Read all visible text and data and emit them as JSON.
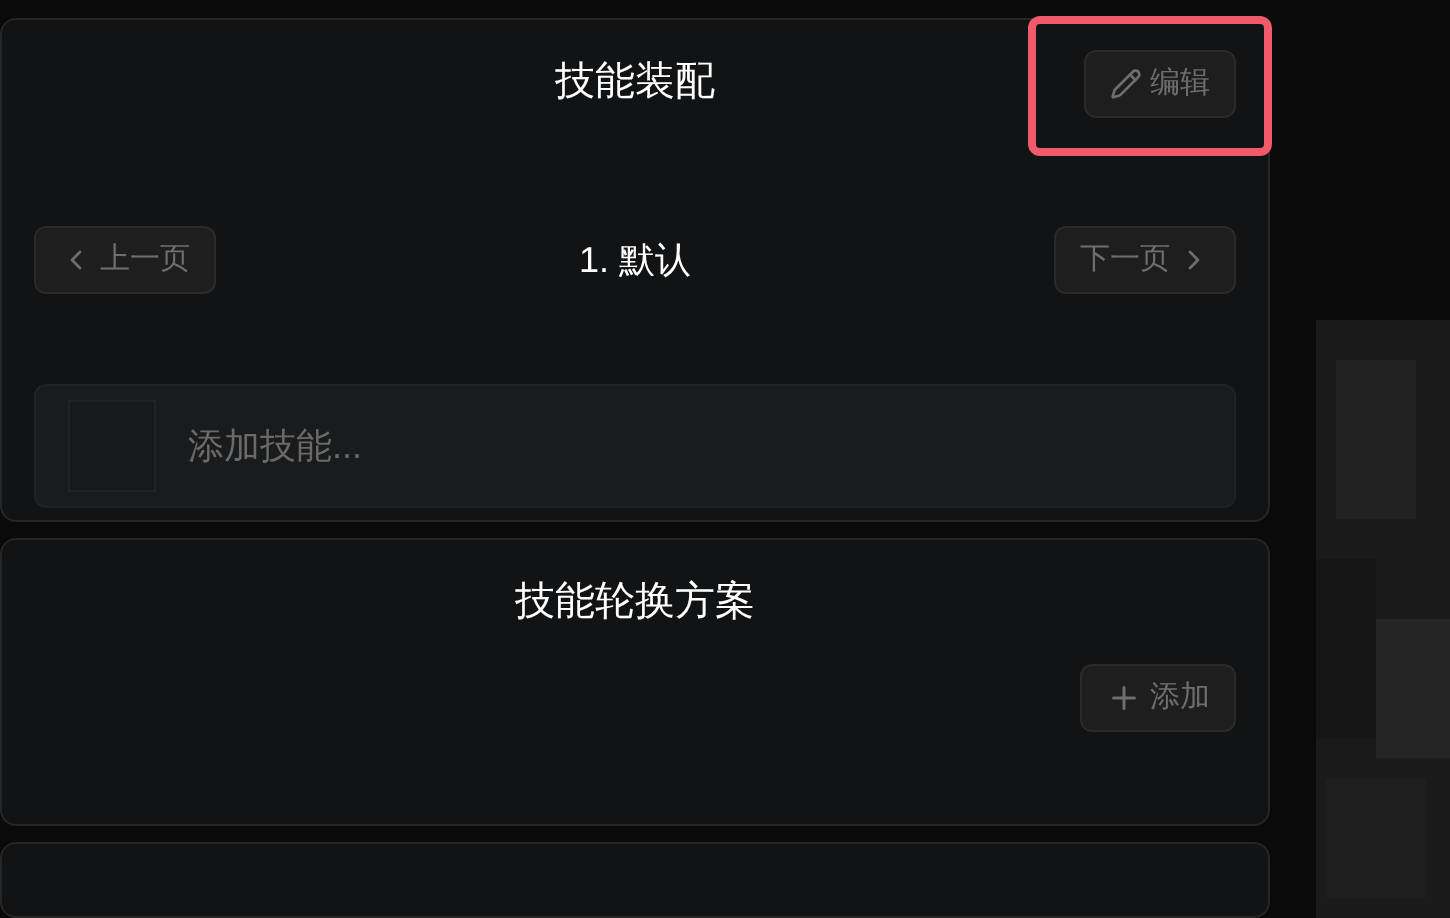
{
  "skill_loadout": {
    "title": "技能装配",
    "edit_button": {
      "label": "编辑",
      "highlighted": true
    },
    "pager": {
      "prev": "上一页",
      "current": "1. 默认",
      "next": "下一页"
    },
    "add_skill": {
      "placeholder": "添加技能..."
    }
  },
  "rotation": {
    "title": "技能轮换方案",
    "add_button": {
      "label": "添加"
    }
  }
}
